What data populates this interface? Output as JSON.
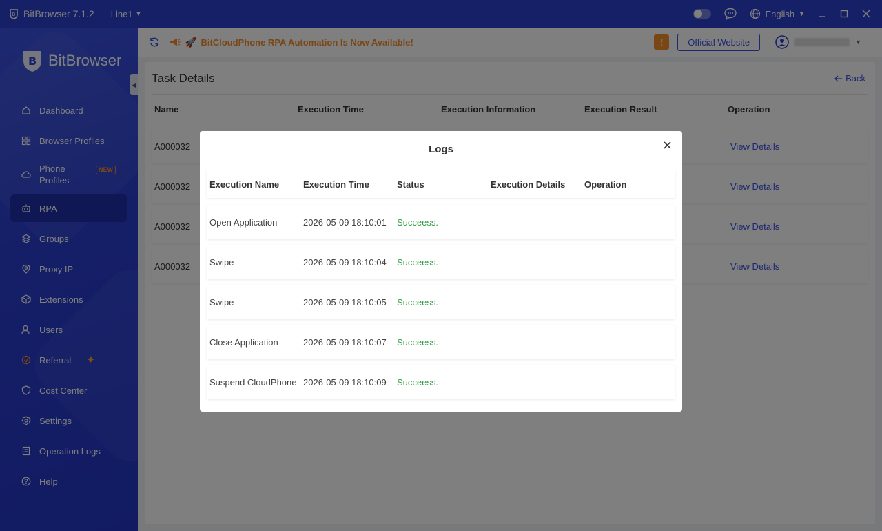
{
  "titlebar": {
    "app_name": "BitBrowser 7.1.2",
    "line": "Line1",
    "language": "English"
  },
  "sidebar": {
    "brand": "BitBrowser",
    "items": [
      {
        "label": "Dashboard",
        "icon": "home-icon"
      },
      {
        "label": "Browser Profiles",
        "icon": "grid-icon"
      },
      {
        "label": "Phone Profiles",
        "icon": "cloud-phone-icon",
        "badge": "NEW"
      },
      {
        "label": "RPA",
        "icon": "robot-icon",
        "active": true
      },
      {
        "label": "Groups",
        "icon": "layers-icon"
      },
      {
        "label": "Proxy IP",
        "icon": "location-icon"
      },
      {
        "label": "Extensions",
        "icon": "cube-icon"
      },
      {
        "label": "Users",
        "icon": "user-icon"
      },
      {
        "label": "Referral",
        "icon": "referral-icon"
      },
      {
        "label": "Cost Center",
        "icon": "shield-icon"
      },
      {
        "label": "Settings",
        "icon": "gear-icon"
      },
      {
        "label": "Operation Logs",
        "icon": "logs-icon"
      },
      {
        "label": "Help",
        "icon": "help-icon"
      }
    ]
  },
  "topbar": {
    "announcement": "BitCloudPhone RPA Automation Is Now Available!",
    "official_website": "Official Website"
  },
  "page": {
    "title": "Task Details",
    "back": "Back",
    "columns": [
      "Name",
      "Execution Time",
      "Execution Information",
      "Execution Result",
      "Operation"
    ],
    "rows": [
      {
        "name": "A000032",
        "operation": "View Details"
      },
      {
        "name": "A000032",
        "operation": "View Details"
      },
      {
        "name": "A000032",
        "operation": "View Details"
      },
      {
        "name": "A000032",
        "operation": "View Details"
      }
    ]
  },
  "modal": {
    "title": "Logs",
    "columns": [
      "Execution Name",
      "Execution Time",
      "Status",
      "Execution Details",
      "Operation"
    ],
    "rows": [
      {
        "name": "Open Application",
        "time": "2026-05-09 18:10:01",
        "status": "Succeess."
      },
      {
        "name": "Swipe",
        "time": "2026-05-09 18:10:04",
        "status": "Succeess."
      },
      {
        "name": "Swipe",
        "time": "2026-05-09 18:10:05",
        "status": "Succeess."
      },
      {
        "name": "Close Application",
        "time": "2026-05-09 18:10:07",
        "status": "Succeess."
      },
      {
        "name": "Suspend CloudPhone",
        "time": "2026-05-09 18:10:09",
        "status": "Succeess."
      }
    ]
  },
  "colors": {
    "primary": "#2c40cf",
    "accent_orange": "#f28c28",
    "success": "#2f9e44",
    "link": "#3c50e0"
  }
}
